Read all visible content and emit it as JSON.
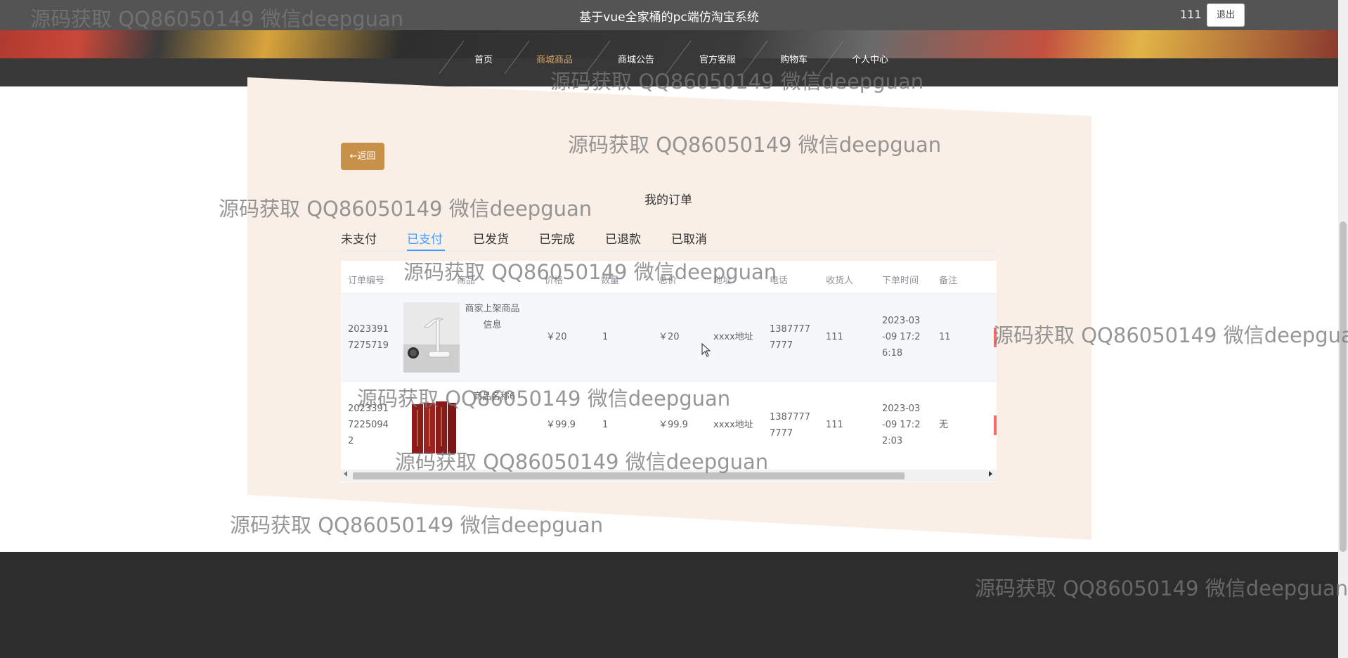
{
  "header": {
    "site_title": "基于vue全家桶的pc端仿淘宝系统",
    "user_name": "111",
    "logout_label": "退出"
  },
  "nav": {
    "items": [
      "首页",
      "商城商品",
      "商城公告",
      "官方客服",
      "购物车",
      "个人中心"
    ],
    "active_index": 1
  },
  "page": {
    "back_label": "←返回",
    "title": "我的订单"
  },
  "tabs": {
    "items": [
      "未支付",
      "已支付",
      "已发货",
      "已完成",
      "已退款",
      "已取消"
    ],
    "active_index": 1
  },
  "table": {
    "columns": [
      "订单编号",
      "商品",
      "价格",
      "数量",
      "总价",
      "地址",
      "电话",
      "收货人",
      "下单时间",
      "备注"
    ],
    "rows": [
      {
        "order_no": [
          "2023391",
          "7275719"
        ],
        "product_name": [
          "商家上架商品",
          "信息"
        ],
        "price": "￥20",
        "quantity": "1",
        "total": "￥20",
        "address": "xxxx地址",
        "phone": [
          "1387777",
          "7777"
        ],
        "receiver": "111",
        "order_time": [
          "2023-03",
          "-09 17:2",
          "6:18"
        ],
        "remark": "11"
      },
      {
        "order_no": [
          "2023391",
          "7225094",
          "2"
        ],
        "product_name": [
          "商品名称6"
        ],
        "price": "￥99.9",
        "quantity": "1",
        "total": "￥99.9",
        "address": "xxxx地址",
        "phone": [
          "1387777",
          "7777"
        ],
        "receiver": "111",
        "order_time": [
          "2023-03",
          "-09 17:2",
          "2:03"
        ],
        "remark": "无"
      }
    ]
  },
  "watermark": "源码获取 QQ86050149 微信deepguan",
  "colors": {
    "accent": "#c8914a",
    "nav_active": "#d9a15a",
    "tab_active": "#409eff",
    "panel": "#faefe6",
    "footer": "#2d2d2d"
  }
}
